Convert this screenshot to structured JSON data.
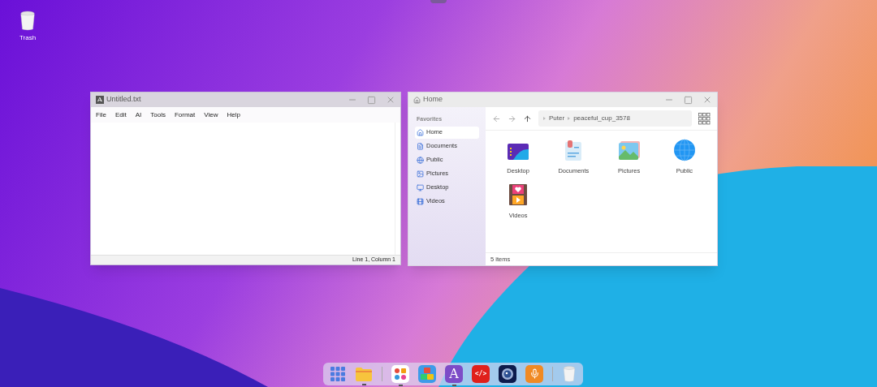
{
  "desktop_icons": [
    {
      "label": "Trash"
    }
  ],
  "editor": {
    "title": "Untitled.txt",
    "app_glyph": "A",
    "menu": [
      "File",
      "Edit",
      "AI",
      "Tools",
      "Format",
      "View",
      "Help"
    ],
    "status": "Line 1, Column 1"
  },
  "files": {
    "title": "Home",
    "sidebar_heading": "Favorites",
    "sidebar_items": [
      {
        "label": "Home",
        "kind": "home",
        "selected": true
      },
      {
        "label": "Documents",
        "kind": "document",
        "selected": false
      },
      {
        "label": "Public",
        "kind": "globe",
        "selected": false
      },
      {
        "label": "Pictures",
        "kind": "image",
        "selected": false
      },
      {
        "label": "Desktop",
        "kind": "monitor",
        "selected": false
      },
      {
        "label": "Videos",
        "kind": "video",
        "selected": false
      }
    ],
    "breadcrumb": [
      "Puter",
      "peaceful_cup_3578"
    ],
    "items": [
      {
        "label": "Desktop",
        "kind": "desktop"
      },
      {
        "label": "Documents",
        "kind": "documents"
      },
      {
        "label": "Pictures",
        "kind": "pictures"
      },
      {
        "label": "Public",
        "kind": "public"
      },
      {
        "label": "Videos",
        "kind": "videos"
      }
    ],
    "status": "5 items"
  },
  "dock": [
    {
      "kind": "launcher",
      "running": false
    },
    {
      "kind": "folder",
      "running": true
    },
    {
      "kind": "divider"
    },
    {
      "kind": "apps",
      "running": true
    },
    {
      "kind": "cubes",
      "running": false
    },
    {
      "kind": "editor",
      "glyph": "A",
      "running": true
    },
    {
      "kind": "code",
      "glyph": "</>",
      "running": false
    },
    {
      "kind": "camera",
      "running": false
    },
    {
      "kind": "mic",
      "running": false
    },
    {
      "kind": "divider"
    },
    {
      "kind": "trash",
      "running": false
    }
  ]
}
